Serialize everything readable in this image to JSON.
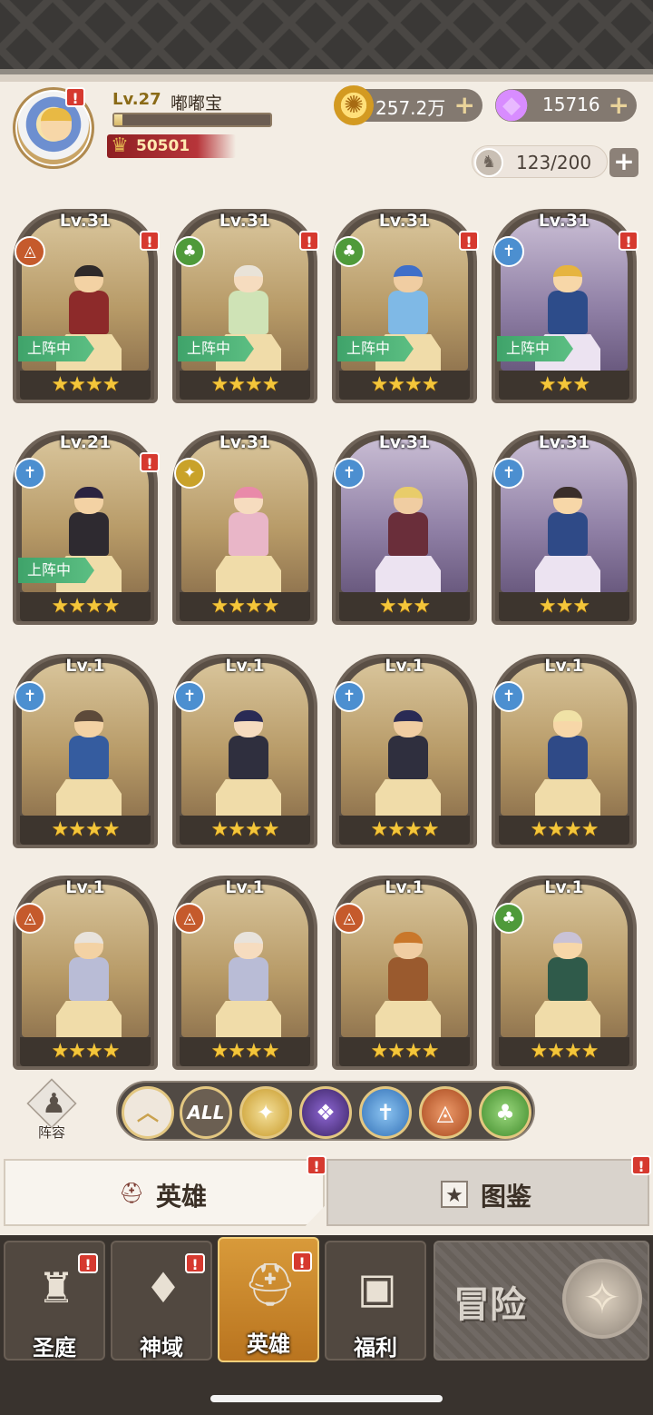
{
  "player": {
    "level_label": "Lv.27",
    "name": "嘟嘟宝",
    "xp_fraction": 0.05,
    "power": "50501"
  },
  "currencies": {
    "gold": "257.2万",
    "gems": "15716"
  },
  "capacity": "123/200",
  "deploy_label": "上阵中",
  "heroes": [
    {
      "level": "Lv.31",
      "faction": "beast",
      "stars": "★★★★",
      "deployed": true,
      "alert": true,
      "bg": "gold"
    },
    {
      "level": "Lv.31",
      "faction": "nature",
      "stars": "★★★★",
      "deployed": true,
      "alert": true,
      "bg": "gold"
    },
    {
      "level": "Lv.31",
      "faction": "nature",
      "stars": "★★★★",
      "deployed": true,
      "alert": true,
      "bg": "gold"
    },
    {
      "level": "Lv.31",
      "faction": "holy",
      "stars": "★★★",
      "deployed": true,
      "alert": true,
      "bg": "purple"
    },
    {
      "level": "Lv.21",
      "faction": "holy",
      "stars": "★★★★",
      "deployed": true,
      "alert": true,
      "bg": "gold"
    },
    {
      "level": "Lv.31",
      "faction": "light",
      "stars": "★★★★",
      "deployed": false,
      "alert": false,
      "bg": "gold"
    },
    {
      "level": "Lv.31",
      "faction": "holy",
      "stars": "★★★",
      "deployed": false,
      "alert": false,
      "bg": "purple"
    },
    {
      "level": "Lv.31",
      "faction": "holy",
      "stars": "★★★",
      "deployed": false,
      "alert": false,
      "bg": "purple"
    },
    {
      "level": "Lv.1",
      "faction": "holy",
      "stars": "★★★★",
      "deployed": false,
      "alert": false,
      "bg": "gold"
    },
    {
      "level": "Lv.1",
      "faction": "holy",
      "stars": "★★★★",
      "deployed": false,
      "alert": false,
      "bg": "gold"
    },
    {
      "level": "Lv.1",
      "faction": "holy",
      "stars": "★★★★",
      "deployed": false,
      "alert": false,
      "bg": "gold"
    },
    {
      "level": "Lv.1",
      "faction": "holy",
      "stars": "★★★★",
      "deployed": false,
      "alert": false,
      "bg": "gold"
    },
    {
      "level": "Lv.1",
      "faction": "beast",
      "stars": "★★★★",
      "deployed": false,
      "alert": false,
      "bg": "gold"
    },
    {
      "level": "Lv.1",
      "faction": "beast",
      "stars": "★★★★",
      "deployed": false,
      "alert": false,
      "bg": "gold"
    },
    {
      "level": "Lv.1",
      "faction": "beast",
      "stars": "★★★★",
      "deployed": false,
      "alert": false,
      "bg": "gold"
    },
    {
      "level": "Lv.1",
      "faction": "nature",
      "stars": "★★★★",
      "deployed": false,
      "alert": false,
      "bg": "gold"
    }
  ],
  "lineup_label": "阵容",
  "filters": {
    "all_label": "ALL",
    "items": [
      "up-arrow-icon",
      "all",
      "light-faction-icon",
      "dark-faction-icon",
      "holy-faction-icon",
      "beast-faction-icon",
      "nature-faction-icon"
    ]
  },
  "tabs": {
    "heroes": "英雄",
    "codex": "图鉴"
  },
  "nav": {
    "items": [
      "圣庭",
      "神域",
      "英雄",
      "福利"
    ],
    "adventure": "冒险"
  },
  "colors": {
    "accent_gold": "#e3c781",
    "alert_red": "#d6392f",
    "deploy_green": "#3fa36a"
  }
}
